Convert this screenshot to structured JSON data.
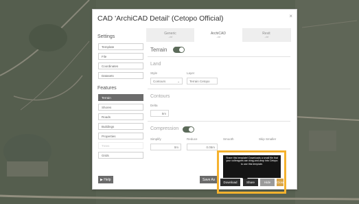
{
  "dialog": {
    "title": "CAD 'ArchiCAD Detail' (Cetopo Official)",
    "close_icon": "×"
  },
  "tabs": [
    {
      "label": "Generic",
      "sub": "..dxf",
      "active": false
    },
    {
      "label": "ArchiCAD",
      "sub": "..dxf",
      "active": true
    },
    {
      "label": "Revit",
      "sub": "..dxf",
      "active": false
    }
  ],
  "sidebar": {
    "settings_heading": "Settings",
    "settings_items": [
      "Template",
      "File",
      "Coordinates",
      "Datasets"
    ],
    "features_heading": "Features",
    "feature_items": [
      {
        "label": "Terrain",
        "active": true
      },
      {
        "label": "Shores",
        "active": false
      },
      {
        "label": "Roads",
        "active": false
      },
      {
        "label": "Buildings",
        "active": false
      },
      {
        "label": "Properties",
        "active": false
      },
      {
        "label": "Trees",
        "active": false,
        "faded": true
      },
      {
        "label": "Grids",
        "active": false
      }
    ],
    "help_label": "Help",
    "help_icon": "play-icon"
  },
  "main": {
    "terrain_label": "Terrain",
    "terrain_on": true,
    "land_label": "Land",
    "style_label": "Style",
    "style_value": "Contours",
    "layer_label": "Layer",
    "layer_value": "Terrain Cetopo",
    "contours_label": "Contours",
    "delta_label": "Delta",
    "delta_value": "5m",
    "compression_label": "Compression",
    "compression_on": true,
    "simplify_label": "Simplify",
    "simplify_value": "0m",
    "reduce_label": "Reduce",
    "reduce_value": "0.05m",
    "smooth_label": "Smooth",
    "skip_label": "Skip Smaller"
  },
  "footer": {
    "save_as_label": "Save As"
  },
  "tooltip": {
    "text": "Share this template! Downloads a small file that your colleagues can drag-and-drop into Cetopo to use this template."
  },
  "popup_buttons": {
    "download": "Download",
    "share": "Share",
    "hide": "Hide",
    "close": "Close"
  },
  "colors": {
    "highlight": "#f5b22e",
    "toggle": "#5c6b5a",
    "active_sidebar": "#6c6c6c"
  }
}
